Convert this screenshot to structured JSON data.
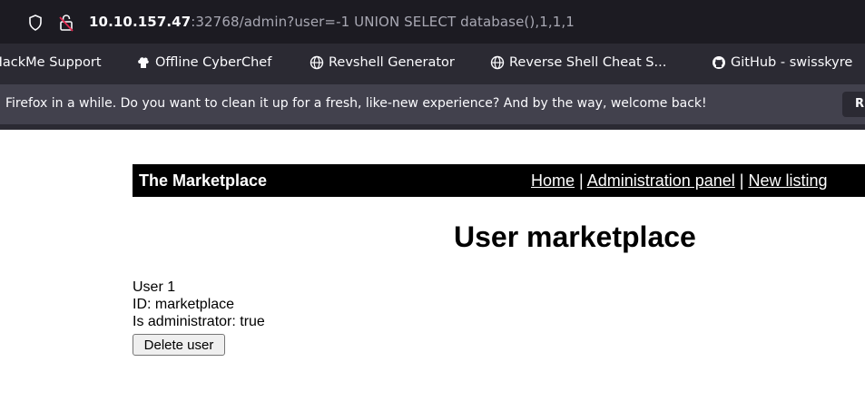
{
  "browser": {
    "url_host": "10.10.157.47",
    "url_rest": ":32768/admin?user=-1 UNION SELECT database(),1,1,1",
    "bookmarks": [
      {
        "label": "HackMe Support",
        "icon": ""
      },
      {
        "label": "Offline CyberChef",
        "icon": "chef-hat-icon"
      },
      {
        "label": "Revshell Generator",
        "icon": "globe-icon"
      },
      {
        "label": "Reverse Shell Cheat S...",
        "icon": "globe-icon"
      },
      {
        "label": "GitHub - swisskyre",
        "icon": "github-icon"
      }
    ],
    "notification": {
      "message": "Firefox in a while. Do you want to clean it up for a fresh, like-new experience? And by the way, welcome back!",
      "button_label": "R"
    }
  },
  "page": {
    "brand": "The Marketplace",
    "nav": {
      "home": "Home",
      "admin": "Administration panel",
      "new_listing": "New listing",
      "sep": " | "
    },
    "heading": "User marketplace",
    "user": {
      "title": "User 1",
      "id_line": "ID: marketplace",
      "admin_line": "Is administrator: true",
      "delete_label": "Delete user"
    }
  },
  "colors": {
    "urlbar_bg": "#1c1b22",
    "bookmarks_bg": "#2b2a33",
    "notification_bg": "#42414d",
    "navbar_bg": "#000000"
  }
}
